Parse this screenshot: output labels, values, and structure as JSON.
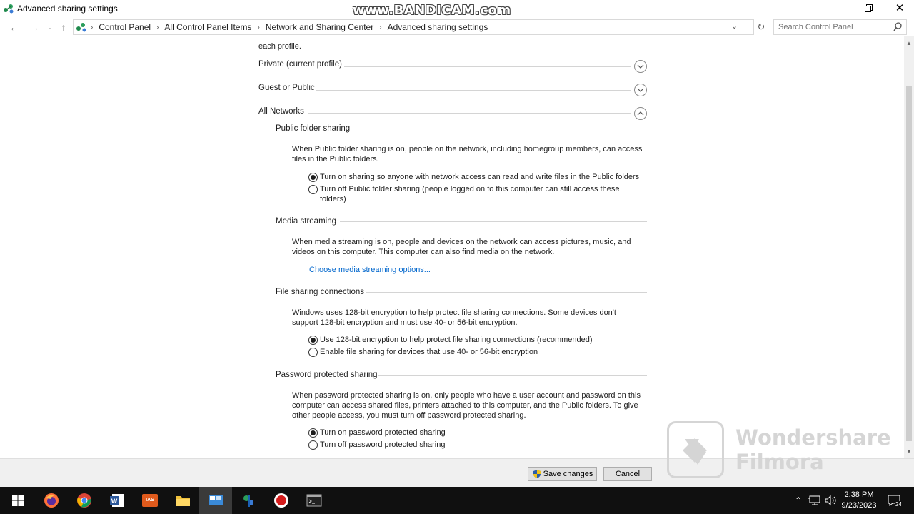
{
  "window": {
    "title": "Advanced sharing settings",
    "watermark": "www.BANDICAM.com"
  },
  "address_bar": {
    "breadcrumbs": [
      "Control Panel",
      "All Control Panel Items",
      "Network and Sharing Center",
      "Advanced sharing settings"
    ],
    "search_placeholder": "Search Control Panel"
  },
  "content": {
    "intro_fragment": "each profile.",
    "profiles": [
      {
        "label": "Private (current profile)",
        "state": "collapsed"
      },
      {
        "label": "Guest or Public",
        "state": "collapsed"
      },
      {
        "label": "All Networks",
        "state": "expanded"
      }
    ],
    "sections": {
      "public_folder": {
        "heading": "Public folder sharing",
        "description": "When Public folder sharing is on, people on the network, including homegroup members, can access files in the Public folders.",
        "options": [
          {
            "label": "Turn on sharing so anyone with network access can read and write files in the Public folders",
            "selected": true
          },
          {
            "label": "Turn off Public folder sharing (people logged on to this computer can still access these folders)",
            "selected": false
          }
        ]
      },
      "media_streaming": {
        "heading": "Media streaming",
        "description": "When media streaming is on, people and devices on the network can access pictures, music, and videos on this computer. This computer can also find media on the network.",
        "link": "Choose media streaming options..."
      },
      "file_sharing": {
        "heading": "File sharing connections",
        "description": "Windows uses 128-bit encryption to help protect file sharing connections. Some devices don't support 128-bit encryption and must use 40- or 56-bit encryption.",
        "options": [
          {
            "label": "Use 128-bit encryption to help protect file sharing connections (recommended)",
            "selected": true
          },
          {
            "label": "Enable file sharing for devices that use 40- or 56-bit encryption",
            "selected": false
          }
        ]
      },
      "password": {
        "heading": "Password protected sharing",
        "description": "When password protected sharing is on, only people who have a user account and password on this computer can access shared files, printers attached to this computer, and the Public folders. To give other people access, you must turn off password protected sharing.",
        "options": [
          {
            "label": "Turn on password protected sharing",
            "selected": true
          },
          {
            "label": "Turn off password protected sharing",
            "selected": false
          }
        ]
      }
    }
  },
  "footer": {
    "save_label": "Save changes",
    "cancel_label": "Cancel"
  },
  "overlay_watermark": {
    "line1": "Wondershare",
    "line2": "Filmora"
  },
  "taskbar": {
    "apps": [
      "start",
      "firefox",
      "chrome",
      "word",
      "ias",
      "file-explorer",
      "control-panel",
      "network-app",
      "recorder",
      "terminal"
    ],
    "clock_time": "2:38 PM",
    "clock_date": "9/23/2023",
    "notification_count": "24"
  }
}
